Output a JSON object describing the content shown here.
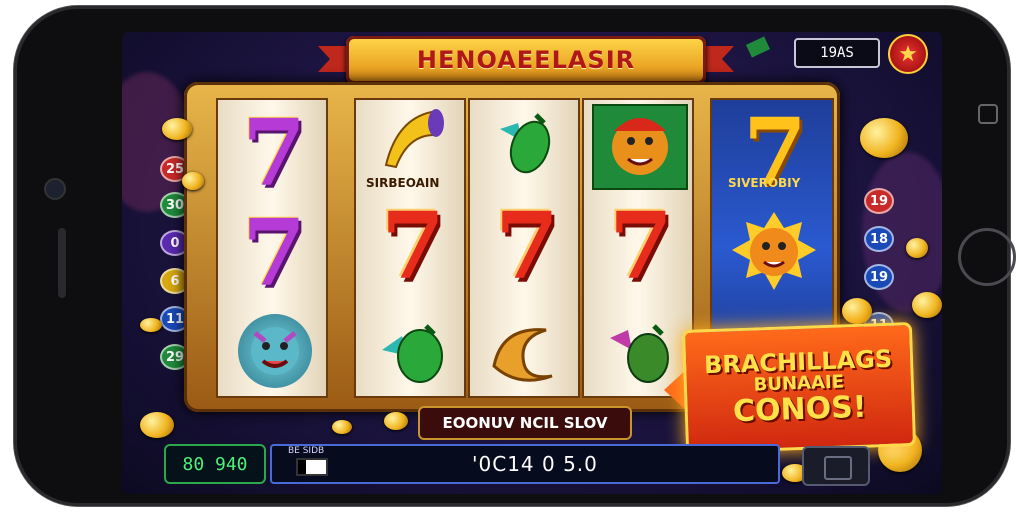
{
  "game": {
    "title": "HENOAEELASIR",
    "score": "19AS",
    "star_button": "★"
  },
  "left_bets": [
    "25",
    "30",
    "0",
    "6",
    "11",
    "29"
  ],
  "right_bets": [
    "19",
    "18",
    "19",
    "11"
  ],
  "reels": {
    "reel2_label": "SIRBEOAIN",
    "reel5_label": "SIVEROBIY",
    "seven_glyph": "7"
  },
  "bottom": {
    "label": "EOONUV NCIL SLOV",
    "credit": "80 940",
    "bet_field_label": "BE SIDB",
    "bet_value": "'0C14 0 5.0"
  },
  "bonus": {
    "line1": "BRACHILLAGS",
    "line2": "BUNAAIE",
    "line3": "CONOS!"
  },
  "colors": {
    "frame_gold": "#e8b64a",
    "title_red": "#b01818",
    "credit_green": "#4cf07a",
    "bonus_orange": "#ff6a1a"
  }
}
